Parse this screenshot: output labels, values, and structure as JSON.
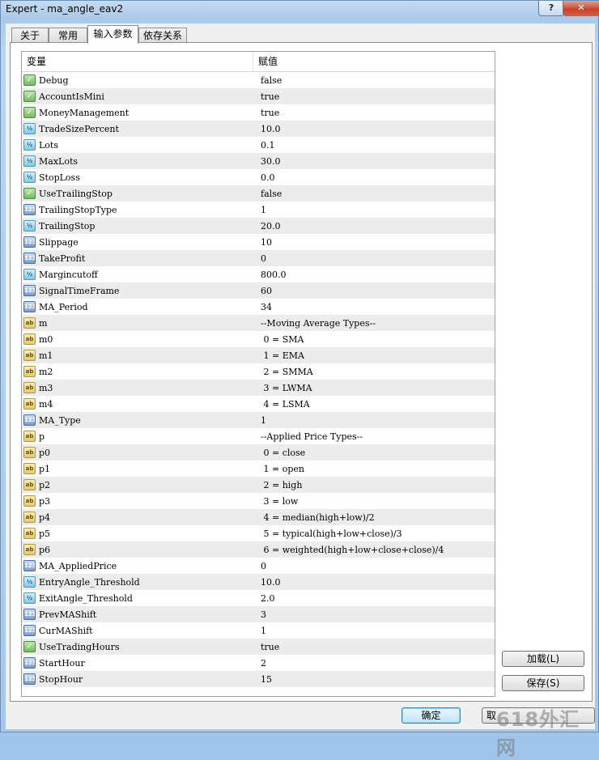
{
  "window": {
    "title": "Expert - ma_angle_eav2",
    "help_label": "?",
    "close_label": "✕"
  },
  "tabs": [
    "关于",
    "常用",
    "输入参数",
    "依存关系"
  ],
  "grid": {
    "headers": {
      "variable": "变量",
      "value": "赋值"
    },
    "rows": [
      {
        "type": "bool",
        "name": "Debug",
        "value": "false"
      },
      {
        "type": "bool",
        "name": "AccountIsMini",
        "value": "true"
      },
      {
        "type": "bool",
        "name": "MoneyManagement",
        "value": "true"
      },
      {
        "type": "double",
        "name": "TradeSizePercent",
        "value": "10.0"
      },
      {
        "type": "double",
        "name": "Lots",
        "value": "0.1"
      },
      {
        "type": "double",
        "name": "MaxLots",
        "value": "30.0"
      },
      {
        "type": "double",
        "name": "StopLoss",
        "value": "0.0"
      },
      {
        "type": "bool",
        "name": "UseTrailingStop",
        "value": "false"
      },
      {
        "type": "int",
        "name": "TrailingStopType",
        "value": "1"
      },
      {
        "type": "double",
        "name": "TrailingStop",
        "value": "20.0"
      },
      {
        "type": "int",
        "name": "Slippage",
        "value": "10"
      },
      {
        "type": "int",
        "name": "TakeProfit",
        "value": "0"
      },
      {
        "type": "double",
        "name": "Margincutoff",
        "value": "800.0"
      },
      {
        "type": "int",
        "name": "SignalTimeFrame",
        "value": "60"
      },
      {
        "type": "int",
        "name": "MA_Period",
        "value": "34"
      },
      {
        "type": "str",
        "name": "m",
        "value": "--Moving Average Types--"
      },
      {
        "type": "str",
        "name": "m0",
        "value": " 0 = SMA"
      },
      {
        "type": "str",
        "name": "m1",
        "value": " 1 = EMA"
      },
      {
        "type": "str",
        "name": "m2",
        "value": " 2 = SMMA"
      },
      {
        "type": "str",
        "name": "m3",
        "value": " 3 = LWMA"
      },
      {
        "type": "str",
        "name": "m4",
        "value": " 4 = LSMA"
      },
      {
        "type": "int",
        "name": "MA_Type",
        "value": "1"
      },
      {
        "type": "str",
        "name": "p",
        "value": "--Applied Price Types--"
      },
      {
        "type": "str",
        "name": "p0",
        "value": " 0 = close"
      },
      {
        "type": "str",
        "name": "p1",
        "value": " 1 = open"
      },
      {
        "type": "str",
        "name": "p2",
        "value": " 2 = high"
      },
      {
        "type": "str",
        "name": "p3",
        "value": " 3 = low"
      },
      {
        "type": "str",
        "name": "p4",
        "value": " 4 = median(high+low)/2"
      },
      {
        "type": "str",
        "name": "p5",
        "value": " 5 = typical(high+low+close)/3"
      },
      {
        "type": "str",
        "name": "p6",
        "value": " 6 = weighted(high+low+close+close)/4"
      },
      {
        "type": "int",
        "name": "MA_AppliedPrice",
        "value": "0"
      },
      {
        "type": "double",
        "name": "EntryAngle_Threshold",
        "value": "10.0"
      },
      {
        "type": "double",
        "name": "ExitAngle_Threshold",
        "value": "2.0"
      },
      {
        "type": "int",
        "name": "PrevMAShift",
        "value": "3"
      },
      {
        "type": "int",
        "name": "CurMAShift",
        "value": "1"
      },
      {
        "type": "bool",
        "name": "UseTradingHours",
        "value": "true"
      },
      {
        "type": "int",
        "name": "StartHour",
        "value": "2"
      },
      {
        "type": "int",
        "name": "StopHour",
        "value": "15"
      }
    ]
  },
  "icons": {
    "bool": "",
    "double": "½",
    "int": "123",
    "str": "ab"
  },
  "buttons": {
    "load": "加载(L)",
    "save": "保存(S)",
    "ok": "确定",
    "cancel": "取"
  },
  "watermark": "618外汇网"
}
